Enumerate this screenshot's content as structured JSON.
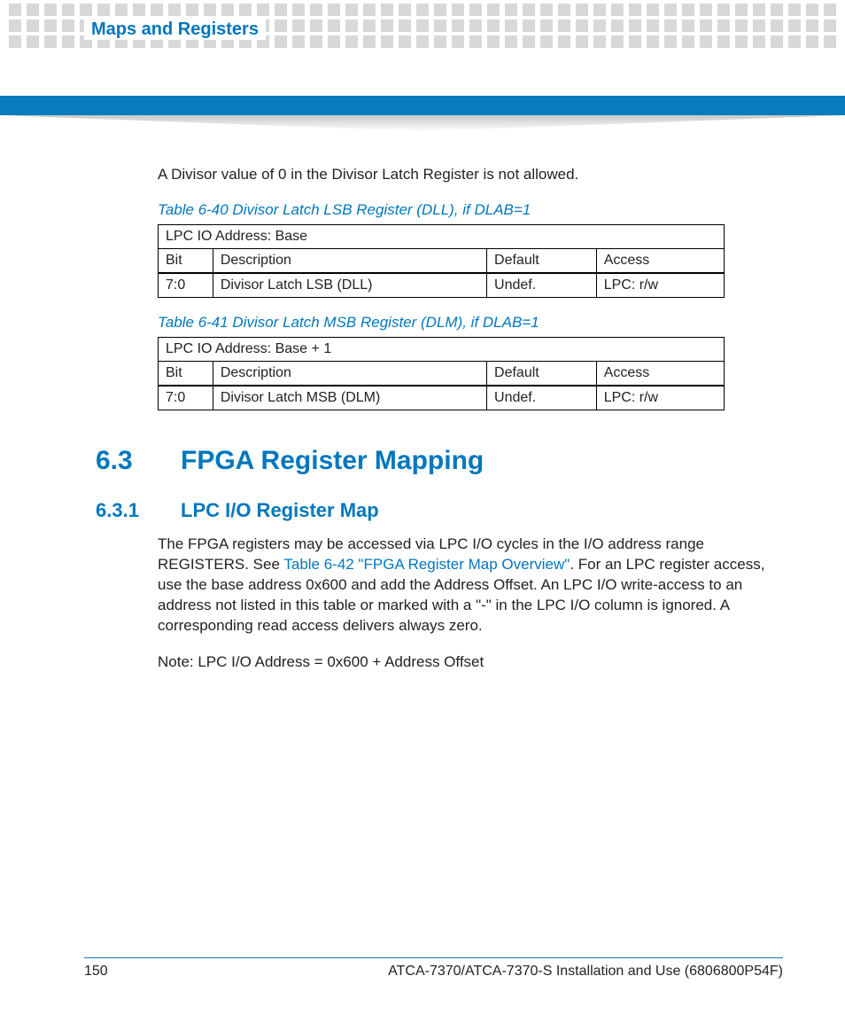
{
  "header": {
    "section_title": "Maps and Registers"
  },
  "intro_para": "A Divisor value of 0 in the Divisor Latch Register is not allowed.",
  "table40": {
    "caption": "Table 6-40  Divisor Latch LSB Register (DLL), if DLAB=1",
    "addr": "LPC IO Address: Base",
    "hdr": {
      "bit": "Bit",
      "desc": "Description",
      "def": "Default",
      "acc": "Access"
    },
    "row": {
      "bit": "7:0",
      "desc": "Divisor Latch LSB (DLL)",
      "def": "Undef.",
      "acc": "LPC: r/w"
    }
  },
  "table41": {
    "caption": "Table 6-41  Divisor Latch MSB Register (DLM), if DLAB=1",
    "addr": "LPC IO Address: Base + 1",
    "hdr": {
      "bit": "Bit",
      "desc": "Description",
      "def": "Default",
      "acc": "Access"
    },
    "row": {
      "bit": "7:0",
      "desc": "Divisor Latch MSB (DLM)",
      "def": "Undef.",
      "acc": "LPC: r/w"
    }
  },
  "h3": {
    "num": "6.3",
    "title": "FPGA Register Mapping"
  },
  "h4": {
    "num": "6.3.1",
    "title": "LPC I/O Register Map"
  },
  "body": {
    "seg1": "The FPGA registers may be accessed via LPC I/O cycles in the I/O address range REGISTERS. See ",
    "xref": "Table 6-42 \"FPGA Register Map Overview\"",
    "seg2": ". For an LPC register access, use the base address 0x600 and add the Address Offset. An LPC I/O write-access to an address not listed in this table or marked with a \"-\" in the LPC I/O column is ignored. A corresponding read access delivers always zero."
  },
  "note": "Note: LPC I/O Address = 0x600 + Address Offset",
  "footer": {
    "page": "150",
    "doc": "ATCA-7370/ATCA-7370-S Installation and Use (6806800P54F)"
  }
}
